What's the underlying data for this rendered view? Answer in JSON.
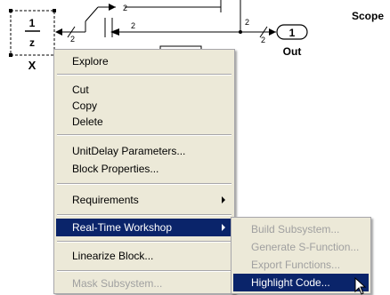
{
  "diagram": {
    "unit_delay": {
      "numerator": "1",
      "denominator": "z",
      "name": "X"
    },
    "outport": {
      "number": "1",
      "name": "Out"
    },
    "scope_label": "Scope",
    "signal_dims": [
      "2",
      "2",
      "2",
      "2",
      "2"
    ]
  },
  "context_menu": {
    "items": [
      {
        "label": "Explore"
      },
      {
        "label": "Cut"
      },
      {
        "label": "Copy"
      },
      {
        "label": "Delete"
      },
      {
        "label": "UnitDelay Parameters..."
      },
      {
        "label": "Block Properties..."
      },
      {
        "label": "Requirements"
      },
      {
        "label": "Real-Time Workshop"
      },
      {
        "label": "Linearize Block..."
      },
      {
        "label": "Mask Subsystem..."
      }
    ]
  },
  "submenu": {
    "items": [
      {
        "label": "Build Subsystem..."
      },
      {
        "label": "Generate S-Function..."
      },
      {
        "label": "Export Functions..."
      },
      {
        "label": "Highlight Code..."
      }
    ]
  },
  "colors": {
    "selection": "#0a246a",
    "menu_bg": "#ece9d8",
    "disabled_text": "#a0a0a0"
  }
}
